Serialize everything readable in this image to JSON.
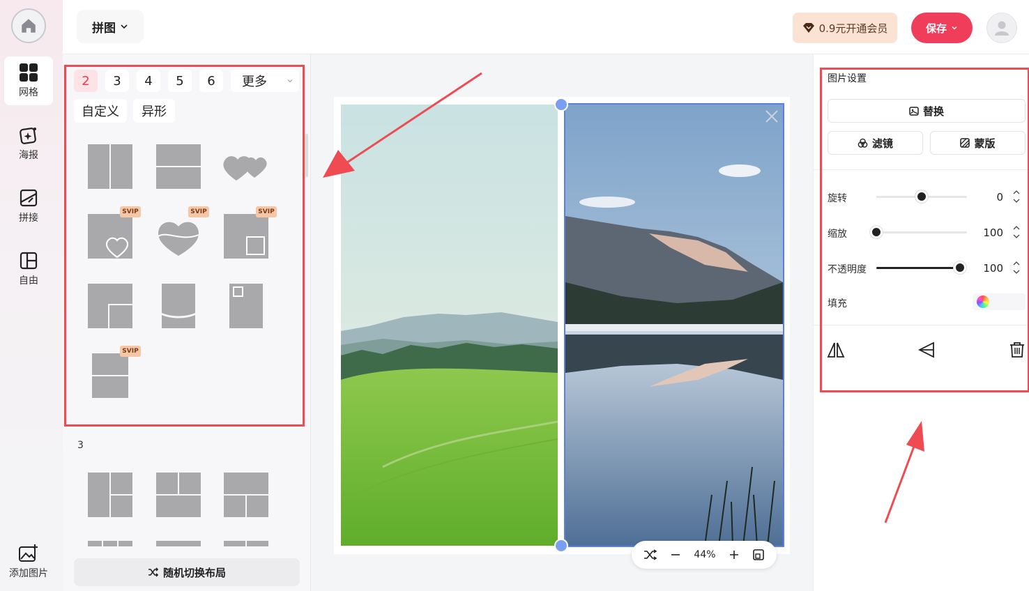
{
  "rail": {
    "items": [
      {
        "label": "网格",
        "icon": "grid-icon",
        "active": true
      },
      {
        "label": "海报",
        "icon": "poster-icon",
        "active": false
      },
      {
        "label": "拼接",
        "icon": "stitch-icon",
        "active": false
      },
      {
        "label": "自由",
        "icon": "free-layout-icon",
        "active": false
      }
    ],
    "add_label": "添加图片"
  },
  "header": {
    "mode_label": "拼图",
    "vip_label": "0.9元开通会员",
    "save_label": "保存"
  },
  "layout_panel": {
    "count_tabs": [
      "2",
      "3",
      "4",
      "5",
      "6"
    ],
    "active_tab": "2",
    "more_label": "更多",
    "tags": [
      "自定义",
      "异形"
    ],
    "svip_badge": "SVIP",
    "section_3_label": "3",
    "random_label": "随机切换布局"
  },
  "canvas": {
    "zoom": "44%"
  },
  "settings": {
    "title": "图片设置",
    "replace_label": "替换",
    "filter_label": "滤镜",
    "mask_label": "蒙版",
    "rotate": {
      "label": "旋转",
      "value": "0",
      "fraction": 0.5
    },
    "scale": {
      "label": "缩放",
      "value": "100",
      "fraction": 0.0
    },
    "opacity": {
      "label": "不透明度",
      "value": "100",
      "fraction": 1.0
    },
    "fill_label": "填充"
  },
  "colors": {
    "accent": "#ef3d5a",
    "annotation_red": "#ee4b52",
    "selection_blue": "#5a7ee6"
  }
}
